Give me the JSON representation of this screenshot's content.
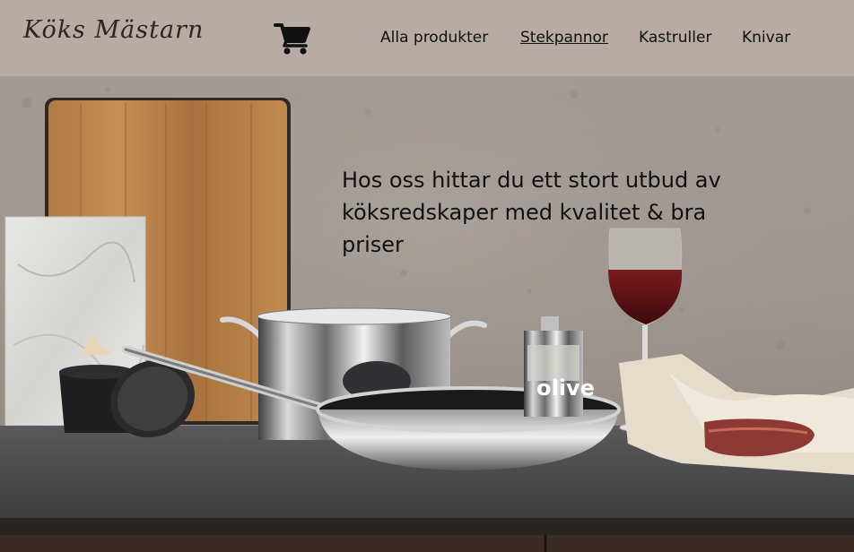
{
  "brand": {
    "logo_text": "Köks Mästarn"
  },
  "header": {
    "cart_icon": "shopping-cart-icon",
    "nav": [
      {
        "label": "Alla produkter",
        "active": false
      },
      {
        "label": "Stekpannor",
        "active": true
      },
      {
        "label": "Kastruller",
        "active": false
      },
      {
        "label": "Knivar",
        "active": false
      }
    ]
  },
  "hero": {
    "headline": "Hos oss hittar du ett stort utbud av köksredskaper med kvalitet & bra priser",
    "oil_can_text": "olive"
  },
  "colors": {
    "header_bg": "#b7aba3",
    "wall": "#a59c95",
    "counter": "#4b4b4d",
    "text": "#111111"
  }
}
